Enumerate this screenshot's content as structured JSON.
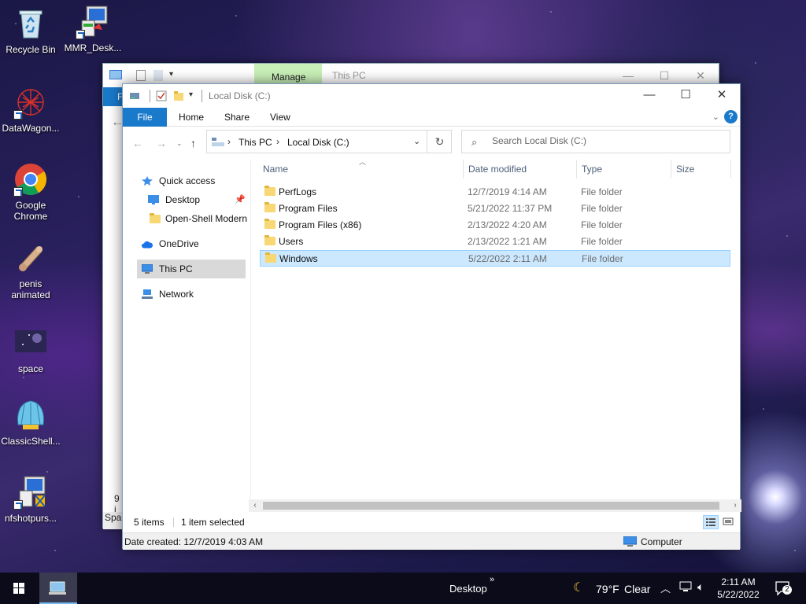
{
  "desktop": {
    "icons": [
      {
        "label": "Recycle Bin"
      },
      {
        "label": "MMR_Desk..."
      },
      {
        "label": "DataWagon..."
      },
      {
        "label": "Google Chrome"
      },
      {
        "label": "penis animated"
      },
      {
        "label": "space"
      },
      {
        "label": "ClassicShell..."
      },
      {
        "label": "nfshotpurs..."
      }
    ]
  },
  "back_window": {
    "manage_tab": "Manage",
    "title": "This PC",
    "ribbon_file_partial": "F",
    "status_partial": "9 i",
    "details_partial": "Spac"
  },
  "window": {
    "title": "Local Disk (C:)",
    "ribbon_tabs": {
      "file": "File",
      "home": "Home",
      "share": "Share",
      "view": "View"
    },
    "help": "?",
    "address": {
      "crumb1": "This PC",
      "crumb2": "Local Disk (C:)"
    },
    "search": {
      "placeholder": "Search Local Disk (C:)"
    },
    "nav": {
      "quick_access": "Quick access",
      "desktop": "Desktop",
      "openshell": "Open-Shell Modern",
      "onedrive": "OneDrive",
      "thispc": "This PC",
      "network": "Network"
    },
    "columns": {
      "name": "Name",
      "date": "Date modified",
      "type": "Type",
      "size": "Size"
    },
    "files": [
      {
        "name": "PerfLogs",
        "date": "12/7/2019 4:14 AM",
        "type": "File folder"
      },
      {
        "name": "Program Files",
        "date": "5/21/2022 11:37 PM",
        "type": "File folder"
      },
      {
        "name": "Program Files (x86)",
        "date": "2/13/2022 4:20 AM",
        "type": "File folder"
      },
      {
        "name": "Users",
        "date": "2/13/2022 1:21 AM",
        "type": "File folder"
      },
      {
        "name": "Windows",
        "date": "5/22/2022 2:11 AM",
        "type": "File folder"
      }
    ],
    "status": {
      "items": "5 items",
      "selected": "1 item selected"
    },
    "details": {
      "date_created": "Date created: 12/7/2019 4:03 AM",
      "location": "Computer"
    }
  },
  "taskbar": {
    "desktop_label": "Desktop",
    "toolbar_chevron": "»",
    "temperature": "79°F",
    "weather": "Clear",
    "time": "2:11 AM",
    "date": "5/22/2022",
    "notification_count": "2"
  },
  "colors": {
    "accent": "#1979ca",
    "selection": "#cce8ff",
    "manage_tab": "#c9f0b8",
    "folder": "#f8d775"
  }
}
